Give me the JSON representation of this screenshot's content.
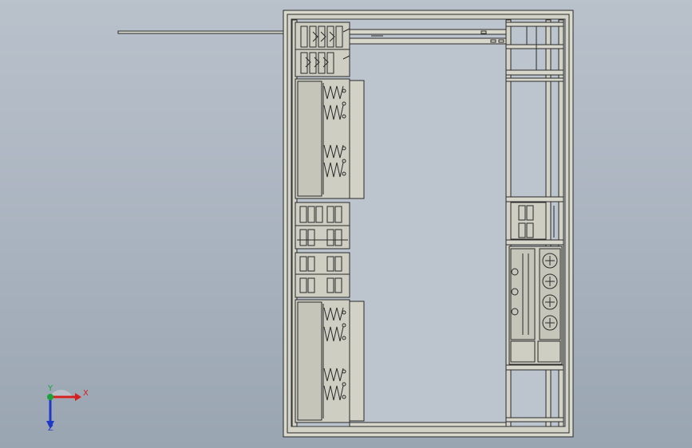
{
  "viewport": {
    "background_top": "#b9c1cb",
    "background_bottom": "#9aa5b2",
    "line_color": "#2a2a2a",
    "frame_fill": "#d9d8cc",
    "panel_fill": "#c9c8bd"
  },
  "triad": {
    "x_label": "X",
    "y_label": "Y",
    "z_label": "Z",
    "x_color": "#d42020",
    "y_color": "#1aa33a",
    "z_color": "#2038c8"
  }
}
